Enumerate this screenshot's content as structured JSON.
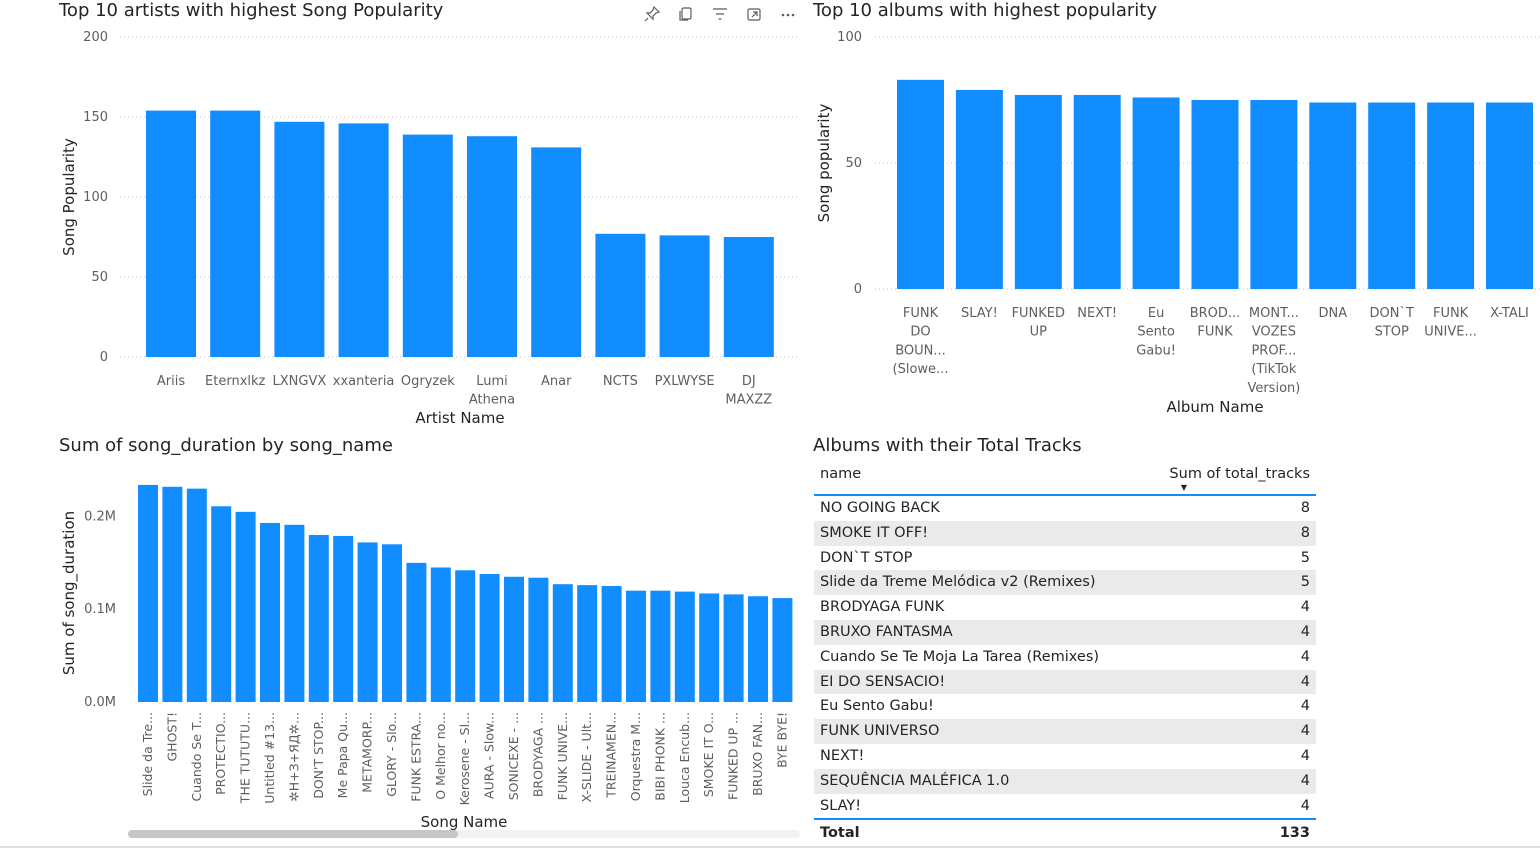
{
  "colors": {
    "bar": "#118dff",
    "grid": "#c8c6c4",
    "text": "#252423",
    "axis_text": "#605e5c"
  },
  "toolbar": {
    "icons": [
      "pin-icon",
      "copy-icon",
      "filter-icon",
      "focus-mode-icon",
      "more-options-icon"
    ]
  },
  "chart_data": [
    {
      "type": "bar",
      "title": "Top 10 artists with highest Song Popularity",
      "xlabel": "Artist Name",
      "ylabel": "Song Popularity",
      "ylim": [
        0,
        200
      ],
      "yticks": [
        "0",
        "50",
        "100",
        "150",
        "200"
      ],
      "categories": [
        "Ariis",
        "Eternxlkz",
        "LXNGVX",
        "xxanteria",
        "Ogryzek",
        "Lumi Athena",
        "Anar",
        "NCTS",
        "PXLWYSE",
        "DJ MAXZZ"
      ],
      "values": [
        154,
        154,
        147,
        146,
        139,
        138,
        131,
        77,
        76,
        75
      ],
      "grid": true
    },
    {
      "type": "bar",
      "title": "Top 10 albums with highest popularity",
      "xlabel": "Album Name",
      "ylabel": "Song popularity",
      "ylim": [
        0,
        100
      ],
      "yticks": [
        "0",
        "50",
        "100"
      ],
      "categories": [
        "FUNK DO BOUN... (Slowe...",
        "SLAY!",
        "FUNKED UP",
        "NEXT!",
        "Eu Sento Gabu!",
        "BROD... FUNK",
        "MONT... VOZES PROF... (TikTok Version)",
        "DNA",
        "DON`T STOP",
        "FUNK UNIVE...",
        "X-TALI"
      ],
      "values": [
        83,
        79,
        77,
        77,
        76,
        75,
        75,
        74,
        74,
        74,
        74
      ],
      "grid": true
    },
    {
      "type": "bar",
      "title": "Sum of song_duration by song_name",
      "xlabel": "Song Name",
      "ylabel": "Sum of song_duration",
      "ylim": [
        0,
        235000
      ],
      "yticks": [
        "0.0M",
        "0.1M",
        "0.2M"
      ],
      "categories": [
        "Slide da Tre...",
        "GHOST!",
        "Cuando Se T...",
        "PROTECTIO...",
        "THE TUTUTU...",
        "Untitled #13...",
        "✲Н+З+ЯД✲...",
        "DON'T STOP...",
        "Me Papa Qu...",
        "METAMORP...",
        "GLORY - Slo...",
        "FUNK ESTRA...",
        "O Melhor no...",
        "Kerosene - Sl...",
        "AURA - Slow...",
        "SONICEXE - ...",
        "BRODYAGA ...",
        "FUNK UNIVE...",
        "X-SLIDE - Ult...",
        "TREINAMEN...",
        "Orquestra M...",
        "BIBI PHONK ...",
        "Louca Encub...",
        "SMOKE IT O...",
        "FUNKED UP ...",
        "BRUXO FAN...",
        "BYE BYE!"
      ],
      "values": [
        234000,
        232000,
        230000,
        211000,
        205000,
        193000,
        191000,
        180000,
        179000,
        172000,
        170000,
        150000,
        145000,
        142000,
        138000,
        135000,
        134000,
        127000,
        126000,
        125000,
        120000,
        120000,
        119000,
        117000,
        116000,
        114000,
        112000
      ],
      "grid": false
    },
    {
      "type": "table",
      "title": "Albums with their Total Tracks",
      "columns": [
        "name",
        "Sum of total_tracks"
      ],
      "rows": [
        [
          "NO GOING BACK",
          "8"
        ],
        [
          "SMOKE IT OFF!",
          "8"
        ],
        [
          "DON`T STOP",
          "5"
        ],
        [
          "Slide da Treme Melódica v2 (Remixes)",
          "5"
        ],
        [
          "BRODYAGA FUNK",
          "4"
        ],
        [
          "BRUXO FANTASMA",
          "4"
        ],
        [
          "Cuando Se Te Moja La Tarea (Remixes)",
          "4"
        ],
        [
          "EI DO SENSACIO!",
          "4"
        ],
        [
          "Eu Sento Gabu!",
          "4"
        ],
        [
          "FUNK UNIVERSO",
          "4"
        ],
        [
          "NEXT!",
          "4"
        ],
        [
          "SEQUÊNCIA MALÉFICA 1.0",
          "4"
        ],
        [
          "SLAY!",
          "4"
        ]
      ],
      "total": [
        "Total",
        "133"
      ]
    }
  ]
}
